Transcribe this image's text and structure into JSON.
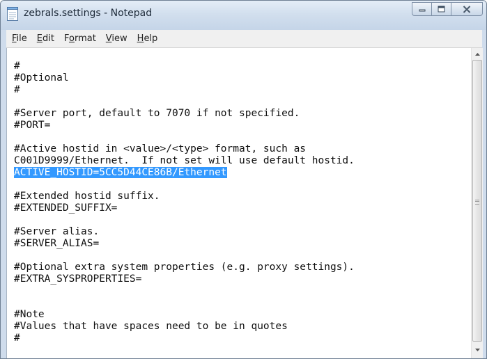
{
  "window": {
    "title": "zebrals.settings - Notepad",
    "accent_color": "#3399ff"
  },
  "caption_buttons": {
    "minimize_icon": "minimize-icon",
    "maximize_icon": "maximize-icon",
    "close_icon": "close-icon"
  },
  "menubar": {
    "items": [
      {
        "label": "File",
        "mnemonic": "F"
      },
      {
        "label": "Edit",
        "mnemonic": "E"
      },
      {
        "label": "Format",
        "mnemonic": "o"
      },
      {
        "label": "View",
        "mnemonic": "V"
      },
      {
        "label": "Help",
        "mnemonic": "H"
      }
    ]
  },
  "editor": {
    "lines": [
      "#",
      "#Optional",
      "#",
      "",
      "#Server port, default to 7070 if not specified.",
      "#PORT=",
      "",
      "#Active hostid in <value>/<type> format, such as",
      "C001D9999/Ethernet.  If not set will use default hostid.",
      "ACTIVE_HOSTID=5CC5D44CE86B/Ethernet",
      "",
      "#Extended hostid suffix.",
      "#EXTENDED_SUFFIX=",
      "",
      "#Server alias.",
      "#SERVER_ALIAS=",
      "",
      "#Optional extra system properties (e.g. proxy settings).",
      "#EXTRA_SYSPROPERTIES=",
      "",
      "",
      "#Note",
      "#Values that have spaces need to be in quotes",
      "#"
    ],
    "selected_line_index": 9,
    "selection_color": "#3399ff"
  }
}
